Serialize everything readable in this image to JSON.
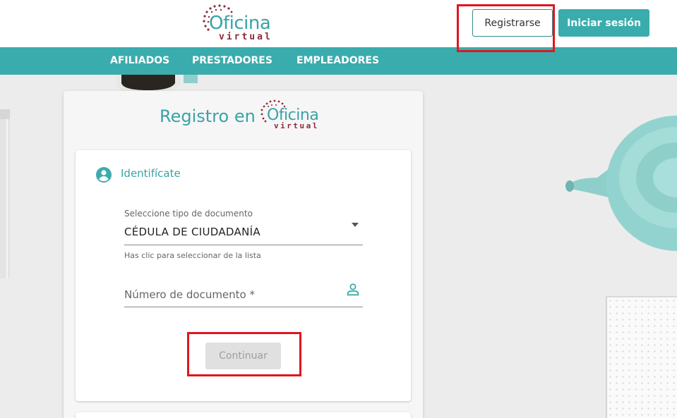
{
  "header": {
    "logo": {
      "word": "Oficina",
      "sub": "virtual"
    },
    "register_label": "Registrarse",
    "login_label": "Iniciar sesión"
  },
  "nav": {
    "items": [
      {
        "label": "AFILIADOS"
      },
      {
        "label": "PRESTADORES"
      },
      {
        "label": "EMPLEADORES"
      }
    ]
  },
  "registration": {
    "title": "Registro en",
    "logo": {
      "word": "Oficina",
      "sub": "virtual"
    },
    "step": {
      "icon": "account-circle-icon",
      "title": "Identifícate"
    },
    "doc_type": {
      "label": "Seleccione tipo de documento",
      "value": "CÉDULA DE CIUDADANÍA",
      "hint": "Has clic para seleccionar de la lista"
    },
    "doc_number": {
      "placeholder": "Número de documento *",
      "icon": "person-outline-icon"
    },
    "continue_label": "Continuar"
  },
  "colors": {
    "brand_teal": "#3aacad",
    "brand_maroon": "#8d2a3a",
    "highlight_red": "#e0161f",
    "disabled_gray": "#e0e0e0"
  }
}
